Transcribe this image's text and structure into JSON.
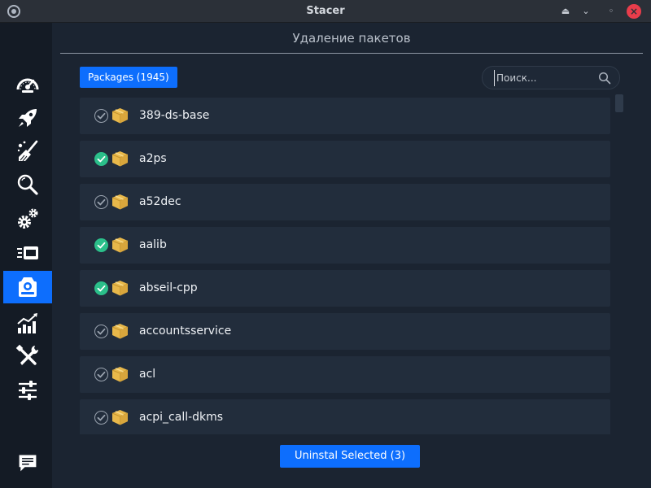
{
  "window": {
    "title": "Stacer",
    "shade_glyph": "⏏",
    "minimize_glyph": "⌄",
    "maximize_glyph": "◦",
    "close_glyph": "×"
  },
  "sidebar": {
    "items": [
      {
        "id": "dashboard",
        "icon": "speedometer-icon",
        "active": false
      },
      {
        "id": "startup",
        "icon": "rocket-icon",
        "active": false
      },
      {
        "id": "cleaner",
        "icon": "broom-icon",
        "active": false
      },
      {
        "id": "search",
        "icon": "magnifier-icon",
        "active": false
      },
      {
        "id": "services",
        "icon": "gears-icon",
        "active": false
      },
      {
        "id": "processes",
        "icon": "process-icon",
        "active": false
      },
      {
        "id": "uninstaller",
        "icon": "package-icon",
        "active": true
      },
      {
        "id": "resources",
        "icon": "bar-chart-icon",
        "active": false
      },
      {
        "id": "helpers",
        "icon": "tools-icon",
        "active": false
      },
      {
        "id": "settings",
        "icon": "sliders-icon",
        "active": false
      }
    ],
    "feedback_icon": "feedback-icon"
  },
  "main": {
    "title": "Удаление пакетов",
    "tab_label": "Packages (1945)",
    "search": {
      "value": "",
      "placeholder": "Поиск..."
    },
    "packages": [
      {
        "name": "389-ds-base",
        "selected": false
      },
      {
        "name": "a2ps",
        "selected": true
      },
      {
        "name": "a52dec",
        "selected": false
      },
      {
        "name": "aalib",
        "selected": true
      },
      {
        "name": "abseil-cpp",
        "selected": true
      },
      {
        "name": "accountsservice",
        "selected": false
      },
      {
        "name": "acl",
        "selected": false
      },
      {
        "name": "acpi_call-dkms",
        "selected": false
      }
    ],
    "uninstall_label": "Uninstal Selected (3)"
  },
  "colors": {
    "accent": "#0d6efd",
    "check_on": "#2bbf8a",
    "close": "#e93d4b",
    "package_box": "#e8b84a"
  }
}
